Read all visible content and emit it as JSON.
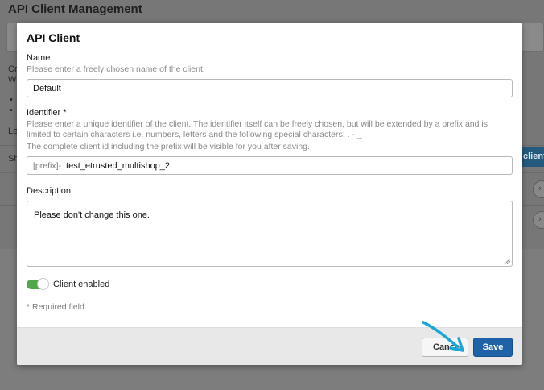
{
  "background": {
    "page_title": "API Client Management",
    "snippet_1": "Cr",
    "snippet_2": "Wi",
    "snippet_3": "Le",
    "snippet_4": "Sh",
    "new_client_label": "client"
  },
  "modal": {
    "title": "API Client",
    "name": {
      "label": "Name",
      "help": "Please enter a freely chosen name of the client.",
      "value": "Default"
    },
    "identifier": {
      "label": "Identifier *",
      "help_1": "Please enter a unique identifier of the client. The identifier itself can be freely chosen, but will be extended by a prefix and is limited to certain characters i.e. numbers, letters and the following special characters: . - _",
      "help_2": "The complete client id including the prefix will be visible for you after saving.",
      "prefix": "[prefix]-",
      "value": "test_etrusted_multishop_2"
    },
    "description": {
      "label": "Description",
      "value": "Please don't change this one."
    },
    "client_enabled": {
      "label": "Client enabled",
      "on": true
    },
    "required_note": "* Required field",
    "buttons": {
      "cancel": "Cancel",
      "save": "Save"
    }
  },
  "colors": {
    "toggle_on": "#54a64a",
    "save_button": "#1f62a8",
    "annotation_arrow": "#1aa6d6"
  }
}
